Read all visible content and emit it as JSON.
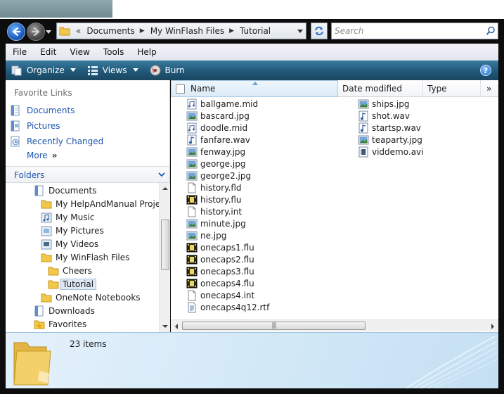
{
  "address": {
    "overflow": "«",
    "crumbs": [
      "Documents",
      "My WinFlash Files",
      "Tutorial"
    ]
  },
  "search": {
    "placeholder": "Search"
  },
  "menu": [
    "File",
    "Edit",
    "View",
    "Tools",
    "Help"
  ],
  "toolbar": {
    "organize": "Organize",
    "views": "Views",
    "burn": "Burn",
    "help": "?"
  },
  "nav": {
    "favorites_title": "Favorite Links",
    "favorites": [
      "Documents",
      "Pictures",
      "Recently Changed"
    ],
    "more": "More",
    "more_chevron": "»",
    "folders_title": "Folders"
  },
  "tree": [
    "Documents",
    "My HelpAndManual Projec",
    "My Music",
    "My Pictures",
    "My Videos",
    "My WinFlash Files",
    "Cheers",
    "Tutorial",
    "OneNote Notebooks",
    "Downloads",
    "Favorites"
  ],
  "columns": {
    "name": "Name",
    "date": "Date modified",
    "type": "Type",
    "more": "»"
  },
  "files_col1": [
    {
      "name": "ballgame.mid",
      "icon": "midi"
    },
    {
      "name": "bascard.jpg",
      "icon": "image"
    },
    {
      "name": "doodle.mid",
      "icon": "midi"
    },
    {
      "name": "fanfare.wav",
      "icon": "audio"
    },
    {
      "name": "fenway.jpg",
      "icon": "image"
    },
    {
      "name": "george.jpg",
      "icon": "image"
    },
    {
      "name": "george2.jpg",
      "icon": "image"
    },
    {
      "name": "history.fld",
      "icon": "blank"
    },
    {
      "name": "history.flu",
      "icon": "film"
    },
    {
      "name": "history.int",
      "icon": "blank"
    },
    {
      "name": "minute.jpg",
      "icon": "image"
    },
    {
      "name": "ne.jpg",
      "icon": "image"
    },
    {
      "name": "onecaps1.flu",
      "icon": "film"
    },
    {
      "name": "onecaps2.flu",
      "icon": "film"
    },
    {
      "name": "onecaps3.flu",
      "icon": "film"
    },
    {
      "name": "onecaps4.flu",
      "icon": "film"
    },
    {
      "name": "onecaps4.int",
      "icon": "blank"
    },
    {
      "name": "onecaps4q12.rtf",
      "icon": "document"
    }
  ],
  "files_col2": [
    {
      "name": "ships.jpg",
      "icon": "image"
    },
    {
      "name": "shot.wav",
      "icon": "audio"
    },
    {
      "name": "startsp.wav",
      "icon": "audio"
    },
    {
      "name": "teaparty.jpg",
      "icon": "image"
    },
    {
      "name": "viddemo.avi",
      "icon": "video"
    }
  ],
  "details": {
    "count": "23 items"
  },
  "scroll": {
    "h_thumb_grip": "|||"
  }
}
